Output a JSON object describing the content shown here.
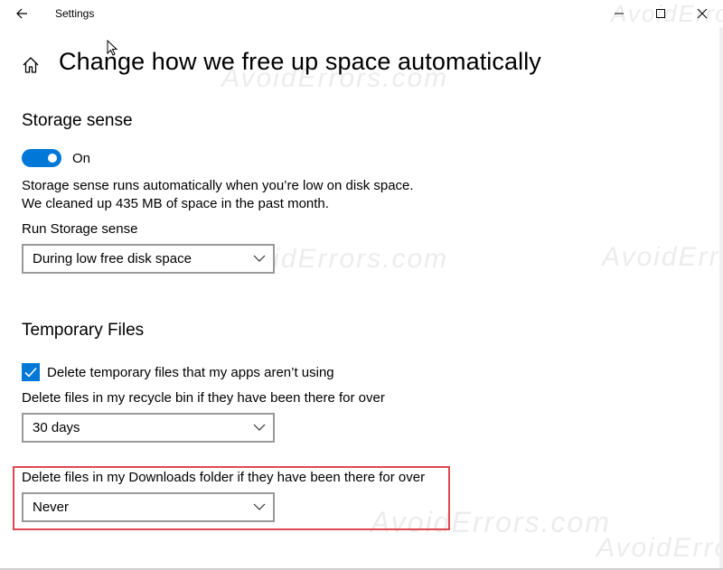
{
  "window": {
    "app_title": "Settings",
    "controls": [
      "minimize",
      "maximize",
      "close"
    ]
  },
  "header": {
    "title": "Change how we free up space automatically"
  },
  "storage_sense": {
    "heading": "Storage sense",
    "toggle_state": "On",
    "toggle_on": true,
    "description_line1": "Storage sense runs automatically when you’re low on disk space.",
    "description_line2": "We cleaned up 435 MB of space in the past month.",
    "run_label": "Run Storage sense",
    "run_value": "During low free disk space"
  },
  "temporary_files": {
    "heading": "Temporary Files",
    "delete_temp_label": "Delete temporary files that my apps aren’t using",
    "delete_temp_checked": true,
    "recycle_label": "Delete files in my recycle bin if they have been there for over",
    "recycle_value": "30 days",
    "downloads_label": "Delete files in my Downloads folder if they have been there for over",
    "downloads_value": "Never"
  },
  "watermark_text": "AvoidErrors.com",
  "colors": {
    "accent": "#0078d7",
    "highlight": "#e0484f",
    "border": "#999999"
  }
}
